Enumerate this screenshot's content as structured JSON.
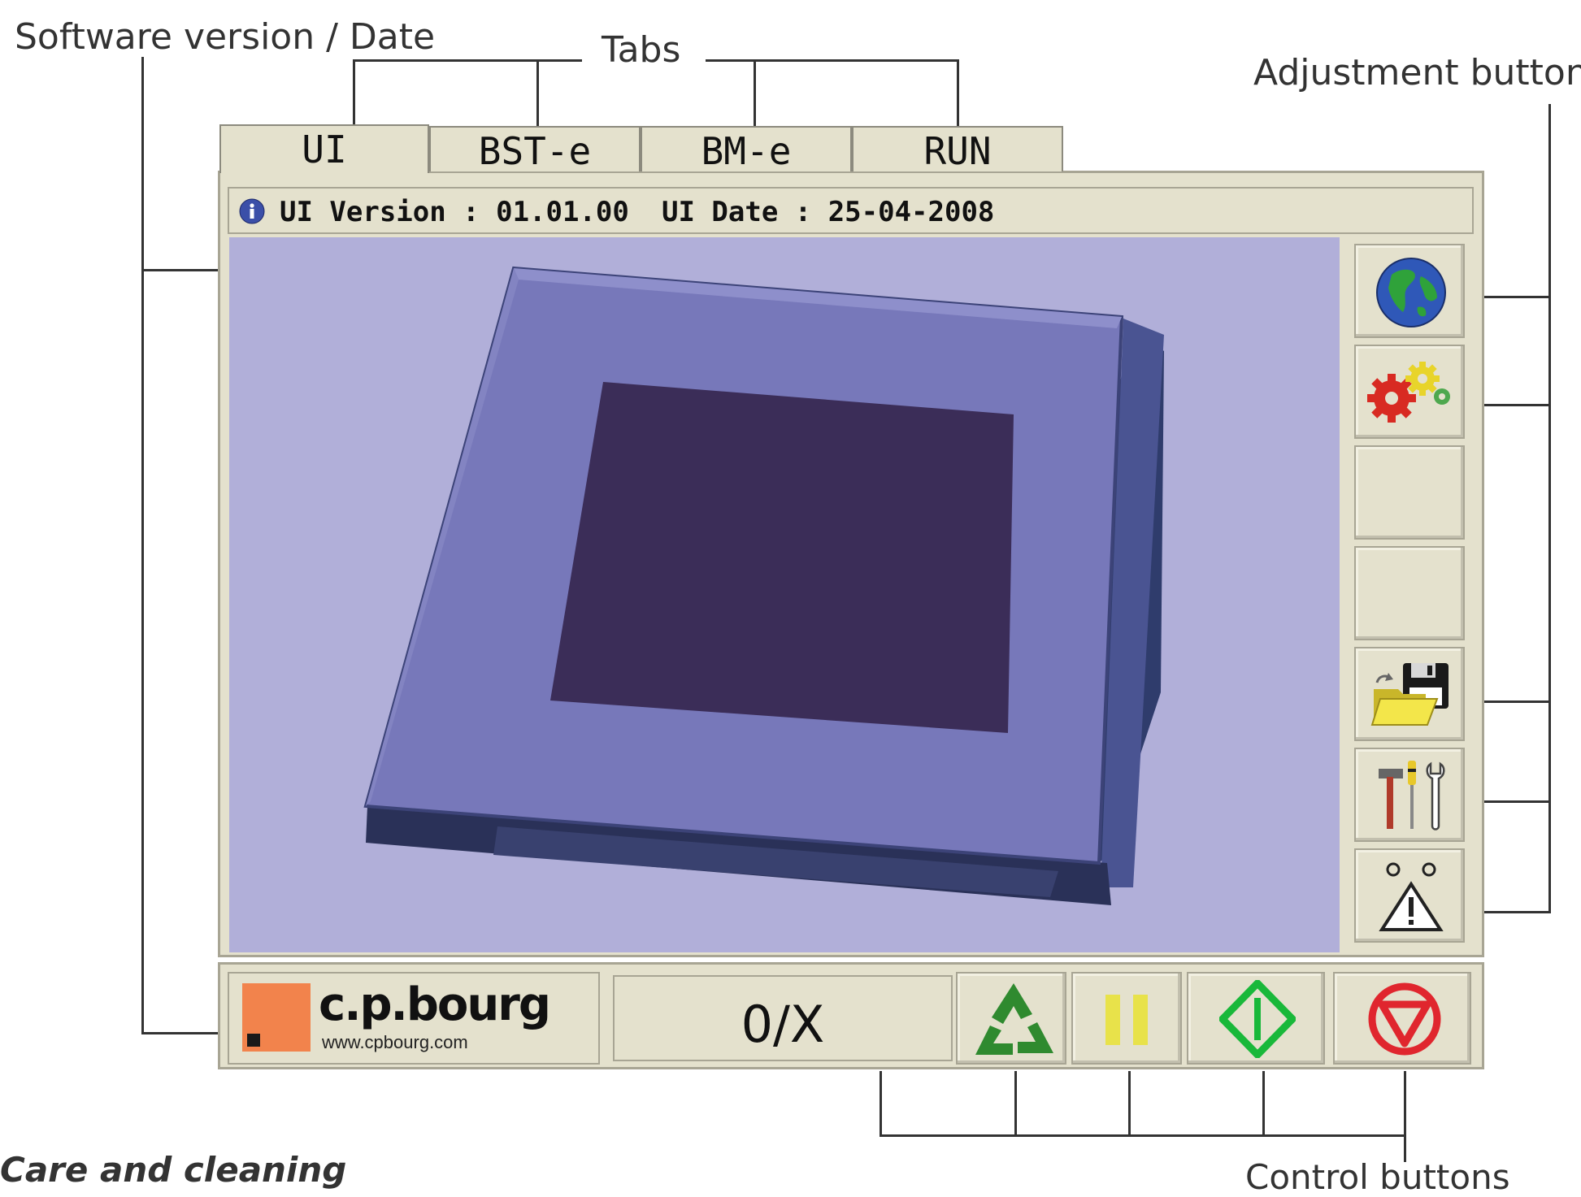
{
  "callouts": {
    "software_version_date": "Software version / Date",
    "tabs": "Tabs",
    "adjustment_buttons": "Adjustment buttons",
    "control_buttons": "Control buttons"
  },
  "caption": "Care and cleaning",
  "tabs": [
    {
      "label": "UI",
      "active": true
    },
    {
      "label": "BST-e",
      "active": false
    },
    {
      "label": "BM-e",
      "active": false
    },
    {
      "label": "RUN",
      "active": false
    }
  ],
  "info_bar": {
    "icon": "info-icon",
    "version_text": "UI Version : 01.01.00",
    "date_text": "UI Date : 25-04-2008"
  },
  "adjustment_buttons": [
    {
      "icon": "globe-icon"
    },
    {
      "icon": "gears-icon"
    },
    {
      "icon": "empty"
    },
    {
      "icon": "empty"
    },
    {
      "icon": "folder-save-icon"
    },
    {
      "icon": "tools-icon"
    },
    {
      "icon": "warning-icon"
    }
  ],
  "logo": {
    "brand": "c.p.bourg",
    "url": "www.cpbourg.com"
  },
  "counter": {
    "value": "0/X"
  },
  "control_buttons": [
    {
      "icon": "recycle-icon"
    },
    {
      "icon": "pause-icon"
    },
    {
      "icon": "start-icon"
    },
    {
      "icon": "stop-icon"
    }
  ],
  "colors": {
    "panel": "#e4e1cd",
    "canvas": "#b1afd9",
    "device_frame": "#7877b9",
    "device_screen": "#3b2d58",
    "logo_square": "#f2834c",
    "recycle": "#2f8a2f",
    "pause": "#e8e24a",
    "start": "#19b83a",
    "stop": "#e0262e"
  }
}
